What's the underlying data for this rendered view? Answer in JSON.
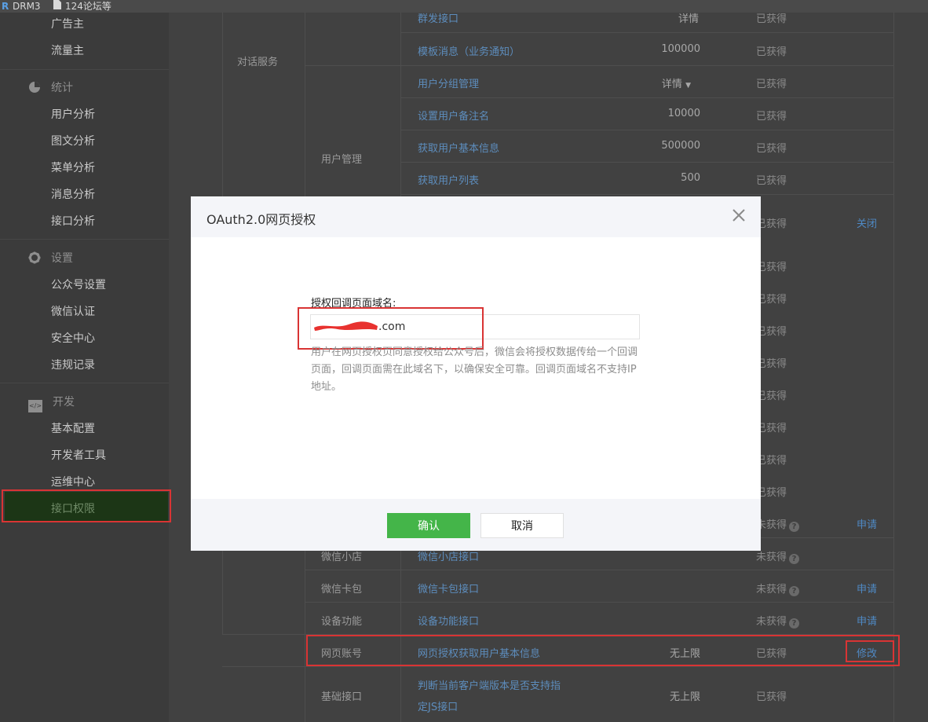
{
  "browser": {
    "tab1": "DRM3",
    "tab2": "124论坛等"
  },
  "sidebar": {
    "items_top": [
      "广告主",
      "流量主"
    ],
    "stats": {
      "title": "统计",
      "items": [
        "用户分析",
        "图文分析",
        "菜单分析",
        "消息分析",
        "接口分析"
      ]
    },
    "settings": {
      "title": "设置",
      "items": [
        "公众号设置",
        "微信认证",
        "安全中心",
        "违规记录"
      ]
    },
    "dev": {
      "title": "开发",
      "icon_text": "</>",
      "items": [
        "基本配置",
        "开发者工具",
        "运维中心",
        "接口权限"
      ]
    }
  },
  "table": {
    "top_partial": {
      "api": "群发接口",
      "quota": "详情",
      "status": "已获得"
    },
    "group_dialog": "对话服务",
    "cat_user": "用户管理",
    "rows": [
      {
        "api": "模板消息（业务通知）",
        "quota": "100000",
        "status": "已获得"
      },
      {
        "api": "用户分组管理",
        "quota": "详情",
        "status": "已获得"
      },
      {
        "api": "设置用户备注名",
        "quota": "10000",
        "status": "已获得"
      },
      {
        "api": "获取用户基本信息",
        "quota": "500000",
        "status": "已获得"
      },
      {
        "api": "获取用户列表",
        "quota": "500",
        "status": "已获得"
      }
    ],
    "hidden_status": [
      "已获得",
      "已获得",
      "已获得",
      "已获得",
      "已获得",
      "已获得",
      "已获得",
      "已获得",
      "已获得",
      "已获得",
      "已获得"
    ],
    "hidden_op": "关闭",
    "under_modal_row": {
      "status": "未获得",
      "op": "申请"
    },
    "row_shop": {
      "cat": "微信小店",
      "api": "微信小店接口",
      "status": "未获得"
    },
    "row_card": {
      "cat": "微信卡包",
      "api": "微信卡包接口",
      "status": "未获得",
      "op": "申请"
    },
    "row_device": {
      "cat": "设备功能",
      "api": "设备功能接口",
      "status": "未获得",
      "op": "申请"
    },
    "row_web": {
      "cat": "网页账号",
      "api": "网页授权获取用户基本信息",
      "quota": "无上限",
      "status": "已获得",
      "op": "修改"
    },
    "row_basic": {
      "cat": "基础接口",
      "api_line1": "判断当前客户端版本是否支持指",
      "api_line2": "定JS接口",
      "quota": "无上限",
      "status": "已获得"
    }
  },
  "modal": {
    "title": "OAuth2.0网页授权",
    "field_label": "授权回调页面域名:",
    "domain_value": ".com",
    "hint": "用户在网页授权页同意授权给公众号后，微信会将授权数据传给一个回调页面，回调页面需在此域名下，以确保安全可靠。回调页面域名不支持IP地址。",
    "confirm": "确认",
    "cancel": "取消"
  }
}
